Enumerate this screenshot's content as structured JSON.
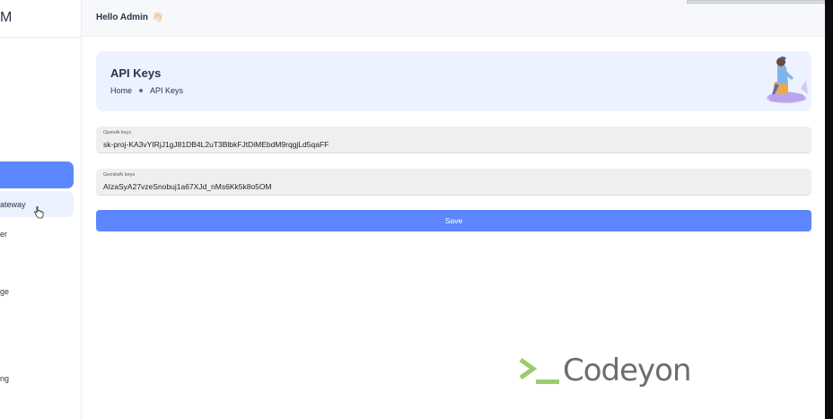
{
  "sidebar": {
    "logo": "M",
    "items": [
      {
        "label": "ateway",
        "state": "hover"
      },
      {
        "label": "er"
      },
      {
        "label": "ge"
      },
      {
        "label": "ng"
      }
    ],
    "active_color": "#5d87ff",
    "hover_color": "#ecf2ff"
  },
  "topbar": {
    "greeting": "Hello Admin",
    "greeting_emoji": "👋🏻"
  },
  "header": {
    "title": "API Keys",
    "breadcrumb": [
      "Home",
      "API Keys"
    ]
  },
  "form": {
    "openai": {
      "label": "OpenAi keys",
      "value": "sk-proj-KA3vYIRjJ1gJ81DB4L2uT3BlbkFJtDiMEbdM9rqgjLd5qaFF"
    },
    "gemini": {
      "label": "GeminiAi keys",
      "value": "AIzaSyA27vzeSnobuj1a67XJd_nMs6Kk5k8o5OM"
    },
    "save_label": "Save"
  },
  "watermark": {
    "text": "Codeyon",
    "prompt_icon": "terminal-prompt-icon",
    "accent_color": "#9acb6e"
  },
  "colors": {
    "primary": "#5d87ff",
    "header_bg": "#ecf2ff",
    "text": "#2a3547"
  }
}
